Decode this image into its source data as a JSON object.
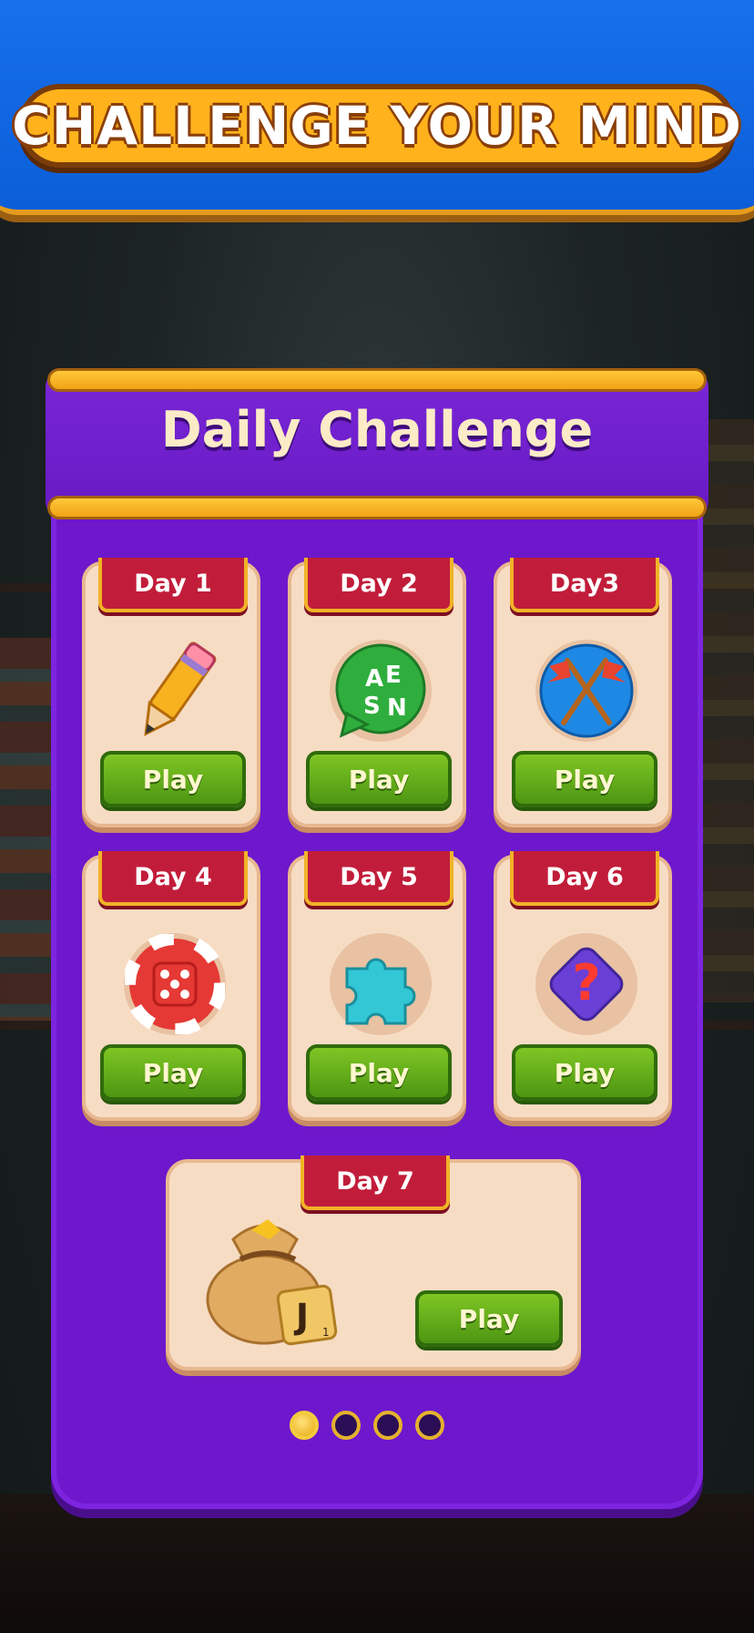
{
  "banner": {
    "title": "CHALLENGE YOUR MIND"
  },
  "panel": {
    "title": "Daily Challenge"
  },
  "days": [
    {
      "label": "Day 1",
      "icon": "pencil-icon",
      "play_label": "Play"
    },
    {
      "label": "Day 2",
      "icon": "letters-bubble-icon",
      "play_label": "Play",
      "letters": [
        "A",
        "E",
        "S",
        "N"
      ]
    },
    {
      "label": "Day3",
      "icon": "crossed-flags-icon",
      "play_label": "Play"
    },
    {
      "label": "Day 4",
      "icon": "dice-lifebuoy-icon",
      "play_label": "Play"
    },
    {
      "label": "Day 5",
      "icon": "puzzle-piece-icon",
      "play_label": "Play"
    },
    {
      "label": "Day 6",
      "icon": "question-mark-icon",
      "play_label": "Play"
    },
    {
      "label": "Day 7",
      "icon": "reward-bag-icon",
      "play_label": "Play",
      "tile_letter": "J",
      "tile_score": "1"
    }
  ],
  "pagination": {
    "total": 4,
    "active": 0
  },
  "colors": {
    "banner_blue": "#1a73f0",
    "panel_purple": "#6d18cc",
    "ribbon_red": "#c11d3a",
    "play_green": "#6bb81d",
    "gold": "#ffb21c"
  }
}
